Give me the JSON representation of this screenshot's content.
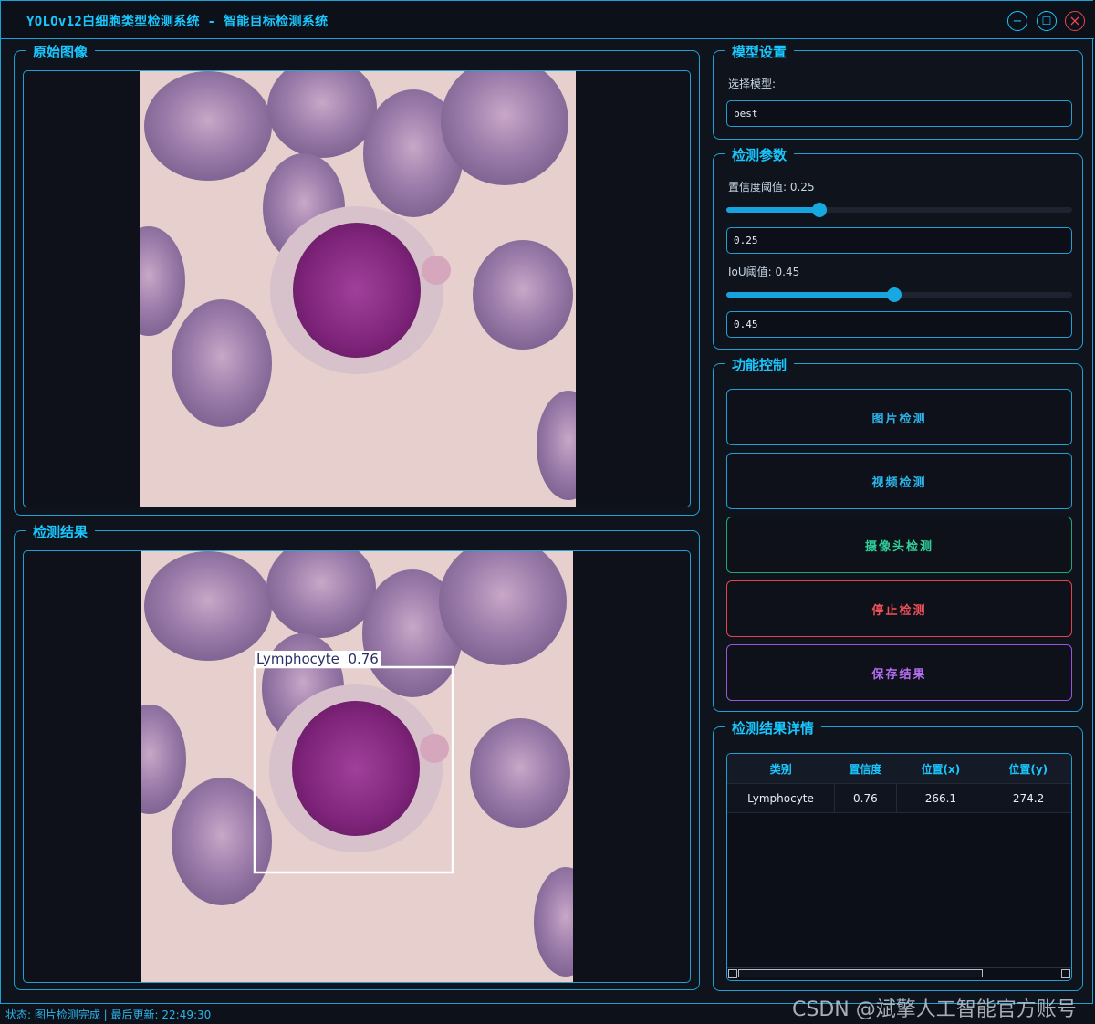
{
  "window": {
    "title": "YOLOv12白细胞类型检测系统 - 智能目标检测系统",
    "minimize_glyph": "−",
    "maximize_glyph": "☐",
    "close_glyph": "×"
  },
  "original_panel": {
    "title": "原始图像"
  },
  "result_panel": {
    "title": "检测结果",
    "detection_label": "Lymphocyte  0.76"
  },
  "model_settings": {
    "title": "模型设置",
    "select_label": "选择模型:",
    "model_value": "best"
  },
  "detect_params": {
    "title": "检测参数",
    "conf_label": "置信度阈值: 0.25",
    "conf_value": "0.25",
    "conf_level": 0.25,
    "iou_label": "IoU阈值: 0.45",
    "iou_value": "0.45",
    "iou_level": 0.45
  },
  "controls": {
    "title": "功能控制",
    "buttons": [
      {
        "label": "图片检测",
        "color": "#2bb6ec",
        "border": "#1f9fd4"
      },
      {
        "label": "视频检测",
        "color": "#2bb6ec",
        "border": "#1f9fd4"
      },
      {
        "label": "摄像头检测",
        "color": "#2fd09a",
        "border": "#1fa57a"
      },
      {
        "label": "停止检测",
        "color": "#f0505a",
        "border": "#e0454e"
      },
      {
        "label": "保存结果",
        "color": "#b36ef0",
        "border": "#9a55df"
      }
    ]
  },
  "details": {
    "title": "检测结果详情",
    "columns": [
      "类别",
      "置信度",
      "位置(x)",
      "位置(y)"
    ],
    "rows": [
      [
        "Lymphocyte",
        "0.76",
        "266.1",
        "274.2"
      ]
    ]
  },
  "status_bar": {
    "text": "状态: 图片检测完成 | 最后更新: 22:49:30"
  },
  "watermark": {
    "text": "CSDN @斌擎人工智能官方账号"
  }
}
